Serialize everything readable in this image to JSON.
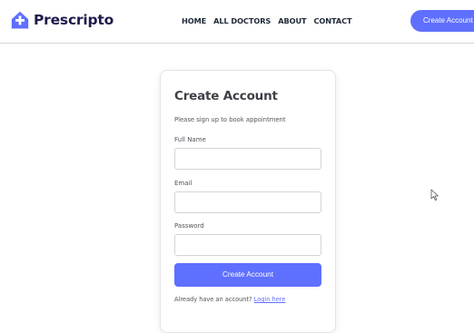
{
  "navbar": {
    "brand": "Prescripto",
    "links": [
      "HOME",
      "ALL DOCTORS",
      "ABOUT",
      "CONTACT"
    ],
    "cta_label": "Create Account",
    "accent_color": "#5f6fff"
  },
  "form": {
    "title": "Create Account",
    "subtitle": "Please sign up to book appointment",
    "fields": [
      {
        "label": "Full Name",
        "value": ""
      },
      {
        "label": "Email",
        "value": ""
      },
      {
        "label": "Password",
        "value": ""
      }
    ],
    "submit_label": "Create Account",
    "login_prompt": "Already have an account?",
    "login_link": "Login here"
  },
  "icons": {
    "logo": "prescripto-logo-icon",
    "cursor": "mouse-pointer-icon"
  }
}
